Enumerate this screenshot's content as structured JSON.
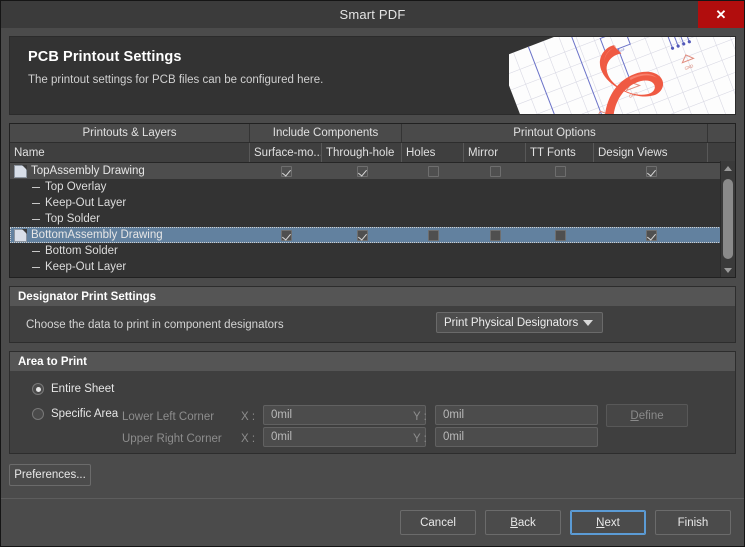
{
  "window": {
    "title": "Smart PDF",
    "close_label": "✕"
  },
  "banner": {
    "title": "PCB Printout Settings",
    "subtitle": "The printout settings for PCB files can be configured here."
  },
  "tree": {
    "group_headers": [
      {
        "label": "Printouts & Layers"
      },
      {
        "label": "Include Components"
      },
      {
        "label": "Printout Options"
      }
    ],
    "columns": [
      {
        "label": "Name"
      },
      {
        "label": "Surface-mo..."
      },
      {
        "label": "Through-hole"
      },
      {
        "label": "Holes"
      },
      {
        "label": "Mirror"
      },
      {
        "label": "TT Fonts"
      },
      {
        "label": "Design Views"
      }
    ],
    "rows": [
      {
        "name": "TopAssembly Drawing",
        "type": "printout",
        "selected": true,
        "focused": false,
        "checks": [
          true,
          true,
          false,
          false,
          false,
          true
        ]
      },
      {
        "name": "Top Overlay",
        "type": "layer",
        "selected": false,
        "focused": false,
        "checks": []
      },
      {
        "name": "Keep-Out Layer",
        "type": "layer",
        "selected": false,
        "focused": false,
        "checks": []
      },
      {
        "name": "Top Solder",
        "type": "layer",
        "selected": false,
        "focused": false,
        "checks": []
      },
      {
        "name": "BottomAssembly Drawing",
        "type": "printout",
        "selected": true,
        "focused": true,
        "checks": [
          true,
          true,
          false,
          false,
          false,
          true
        ]
      },
      {
        "name": "Bottom Solder",
        "type": "layer",
        "selected": false,
        "focused": false,
        "checks": []
      },
      {
        "name": "Keep-Out Layer",
        "type": "layer",
        "selected": false,
        "focused": false,
        "checks": []
      }
    ]
  },
  "designator": {
    "section_title": "Designator Print Settings",
    "prompt": "Choose the data to print in component designators",
    "select_value": "Print Physical Designators"
  },
  "area": {
    "section_title": "Area to Print",
    "entire_sheet_label": "Entire Sheet",
    "specific_area_label": "Specific Area",
    "entire_sheet_selected": true,
    "specific_area_selected": false,
    "lower_left_label": "Lower Left Corner",
    "upper_right_label": "Upper Right Corner",
    "x_label": "X :",
    "y_label": "Y :",
    "lower_left_x": "0mil",
    "lower_left_y": "0mil",
    "upper_right_x": "0mil",
    "upper_right_y": "0mil",
    "define_label": "Define",
    "define_accel": "D",
    "define_rest": "efine",
    "define_disabled": true
  },
  "buttons": {
    "preferences": "Preferences...",
    "cancel": "Cancel",
    "back_accel": "B",
    "back_rest": "ack",
    "next_accel": "N",
    "next_rest": "ext",
    "finish": "Finish"
  },
  "colors": {
    "accent_close": "#b10d0d",
    "selection_blue": "#62819f",
    "focus_blue": "#5b9bd5",
    "acrobat_red": "#ef5a43"
  }
}
